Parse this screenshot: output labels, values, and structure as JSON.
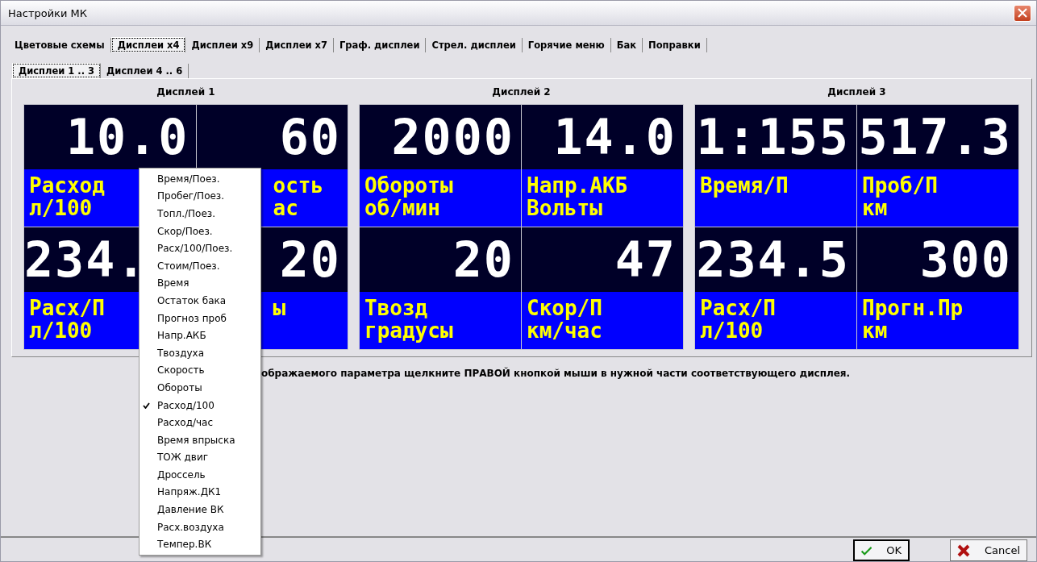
{
  "window": {
    "title": "Настройки МК"
  },
  "tabs": [
    {
      "label": "Цветовые схемы",
      "selected": false
    },
    {
      "label": "Дисплеи x4",
      "selected": true
    },
    {
      "label": "Дисплеи x9",
      "selected": false
    },
    {
      "label": "Дисплеи x7",
      "selected": false
    },
    {
      "label": "Граф. дисплеи",
      "selected": false
    },
    {
      "label": "Стрел. дисплеи",
      "selected": false
    },
    {
      "label": "Горячие меню",
      "selected": false
    },
    {
      "label": "Бак",
      "selected": false
    },
    {
      "label": "Поправки",
      "selected": false
    }
  ],
  "subtabs": [
    {
      "label": "Дисплеи 1 .. 3",
      "selected": true
    },
    {
      "label": "Дисплеи 4 .. 6",
      "selected": false
    }
  ],
  "displays": [
    {
      "title": "Дисплей 1",
      "cells": [
        {
          "value": "10.0",
          "label": [
            "Расход",
            "л/100"
          ]
        },
        {
          "value": "60",
          "label": [
            "ость",
            "ас"
          ]
        },
        {
          "value": "234.",
          "label": [
            "Расх/П",
            "л/100"
          ]
        },
        {
          "value": "20",
          "label": [
            "ы"
          ]
        }
      ]
    },
    {
      "title": "Дисплей 2",
      "cells": [
        {
          "value": "2000",
          "label": [
            "Обороты",
            "об/мин"
          ]
        },
        {
          "value": "14.0",
          "label": [
            "Напр.АКБ",
            "Вольты"
          ]
        },
        {
          "value": "20",
          "label": [
            "Твозд",
            "градусы"
          ]
        },
        {
          "value": "47",
          "label": [
            "Скор/П",
            "км/час"
          ]
        }
      ]
    },
    {
      "title": "Дисплей 3",
      "cells": [
        {
          "value": "1:155",
          "label": [
            "Время/П"
          ]
        },
        {
          "value": "517.3",
          "label": [
            "Проб/П",
            "км"
          ]
        },
        {
          "value": "234.5",
          "label": [
            "Расх/П",
            "л/100"
          ]
        },
        {
          "value": "300",
          "label": [
            "Прогн.Пр",
            "км"
          ]
        }
      ]
    }
  ],
  "instruction": "ображаемого параметра щелкните ПРАВОЙ кнопкой мыши в нужной части соответствующего дисплея.",
  "context_menu": [
    {
      "label": "Время/Поез.",
      "checked": false
    },
    {
      "label": "Пробег/Поез.",
      "checked": false
    },
    {
      "label": "Топл./Поез.",
      "checked": false
    },
    {
      "label": "Скор/Поез.",
      "checked": false
    },
    {
      "label": "Расх/100/Поез.",
      "checked": false
    },
    {
      "label": "Стоим/Поез.",
      "checked": false
    },
    {
      "label": "Время",
      "checked": false
    },
    {
      "label": "Остаток бака",
      "checked": false
    },
    {
      "label": "Прогноз проб",
      "checked": false
    },
    {
      "label": "Напр.АКБ",
      "checked": false
    },
    {
      "label": "Твоздуха",
      "checked": false
    },
    {
      "label": "Скорость",
      "checked": false
    },
    {
      "label": "Обороты",
      "checked": false
    },
    {
      "label": "Расход/100",
      "checked": true
    },
    {
      "label": "Расход/час",
      "checked": false
    },
    {
      "label": "Время впрыска",
      "checked": false
    },
    {
      "label": "ТОЖ двиг",
      "checked": false
    },
    {
      "label": "Дроссель",
      "checked": false
    },
    {
      "label": "Напряж.ДК1",
      "checked": false
    },
    {
      "label": "Давление ВК",
      "checked": false
    },
    {
      "label": "Расх.воздуха",
      "checked": false
    },
    {
      "label": "Темпер.ВК",
      "checked": false
    }
  ],
  "buttons": [
    {
      "kind": "ok",
      "label": "OK"
    },
    {
      "kind": "cancel",
      "label": "Cancel"
    }
  ]
}
